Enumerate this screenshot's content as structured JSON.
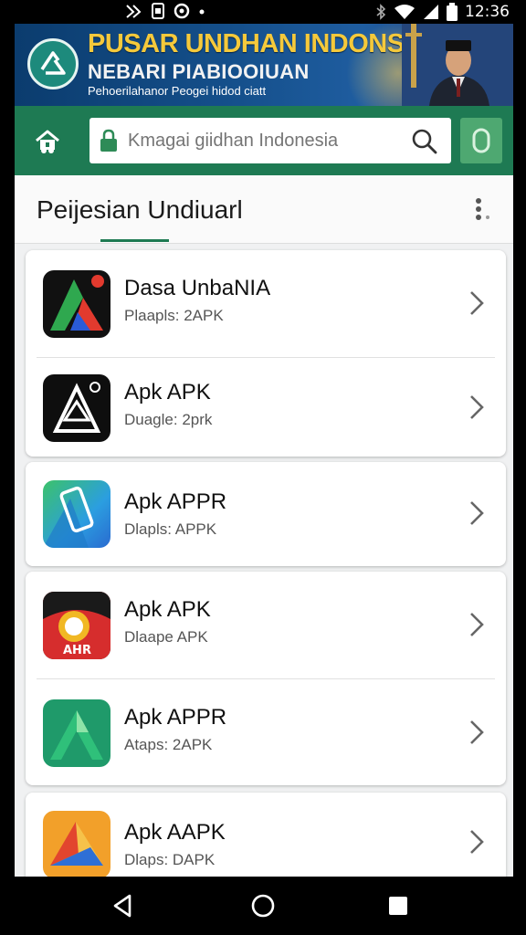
{
  "status_bar": {
    "time": "12:36",
    "icons": [
      "bluetooth-icon",
      "wifi-icon",
      "signal-icon",
      "battery-icon"
    ]
  },
  "banner": {
    "title": "PUSAR UNDHAN INDONSIA",
    "subtitle": "NEBARI PIABIOOIUAN",
    "tagline": "Pehoerilahanor Peogei hidod ciatt"
  },
  "toolbar": {
    "search_placeholder": "Kmagai giidhan Indonesia",
    "home_icon": "home-icon",
    "search_icon": "search-icon",
    "badge_icon": "coin-icon"
  },
  "section": {
    "title": "Peijesian Undiuarl"
  },
  "apps": [
    {
      "name": "Dasa UnbaNIA",
      "meta": "Plaapls: 2APK",
      "icon": "app-icon-red-green"
    },
    {
      "name": "Apk APK",
      "meta": "Duagle: 2prk",
      "icon": "app-icon-black-white"
    },
    {
      "name": "Apk APPR",
      "meta": "Dlapls: APPK",
      "icon": "app-icon-blue-phone"
    },
    {
      "name": "Apk APK",
      "meta": "Dlaape APK",
      "icon": "app-icon-red-yellow"
    },
    {
      "name": "Apk APPR",
      "meta": "Ataps: 2APK",
      "icon": "app-icon-green"
    },
    {
      "name": "Apk AAPK",
      "meta": "Dlaps: DAPK",
      "icon": "app-icon-orange-blue"
    }
  ],
  "colors": {
    "toolbar_green": "#1e7a53",
    "banner_blue": "#15508c",
    "banner_gold": "#f5c93b"
  }
}
